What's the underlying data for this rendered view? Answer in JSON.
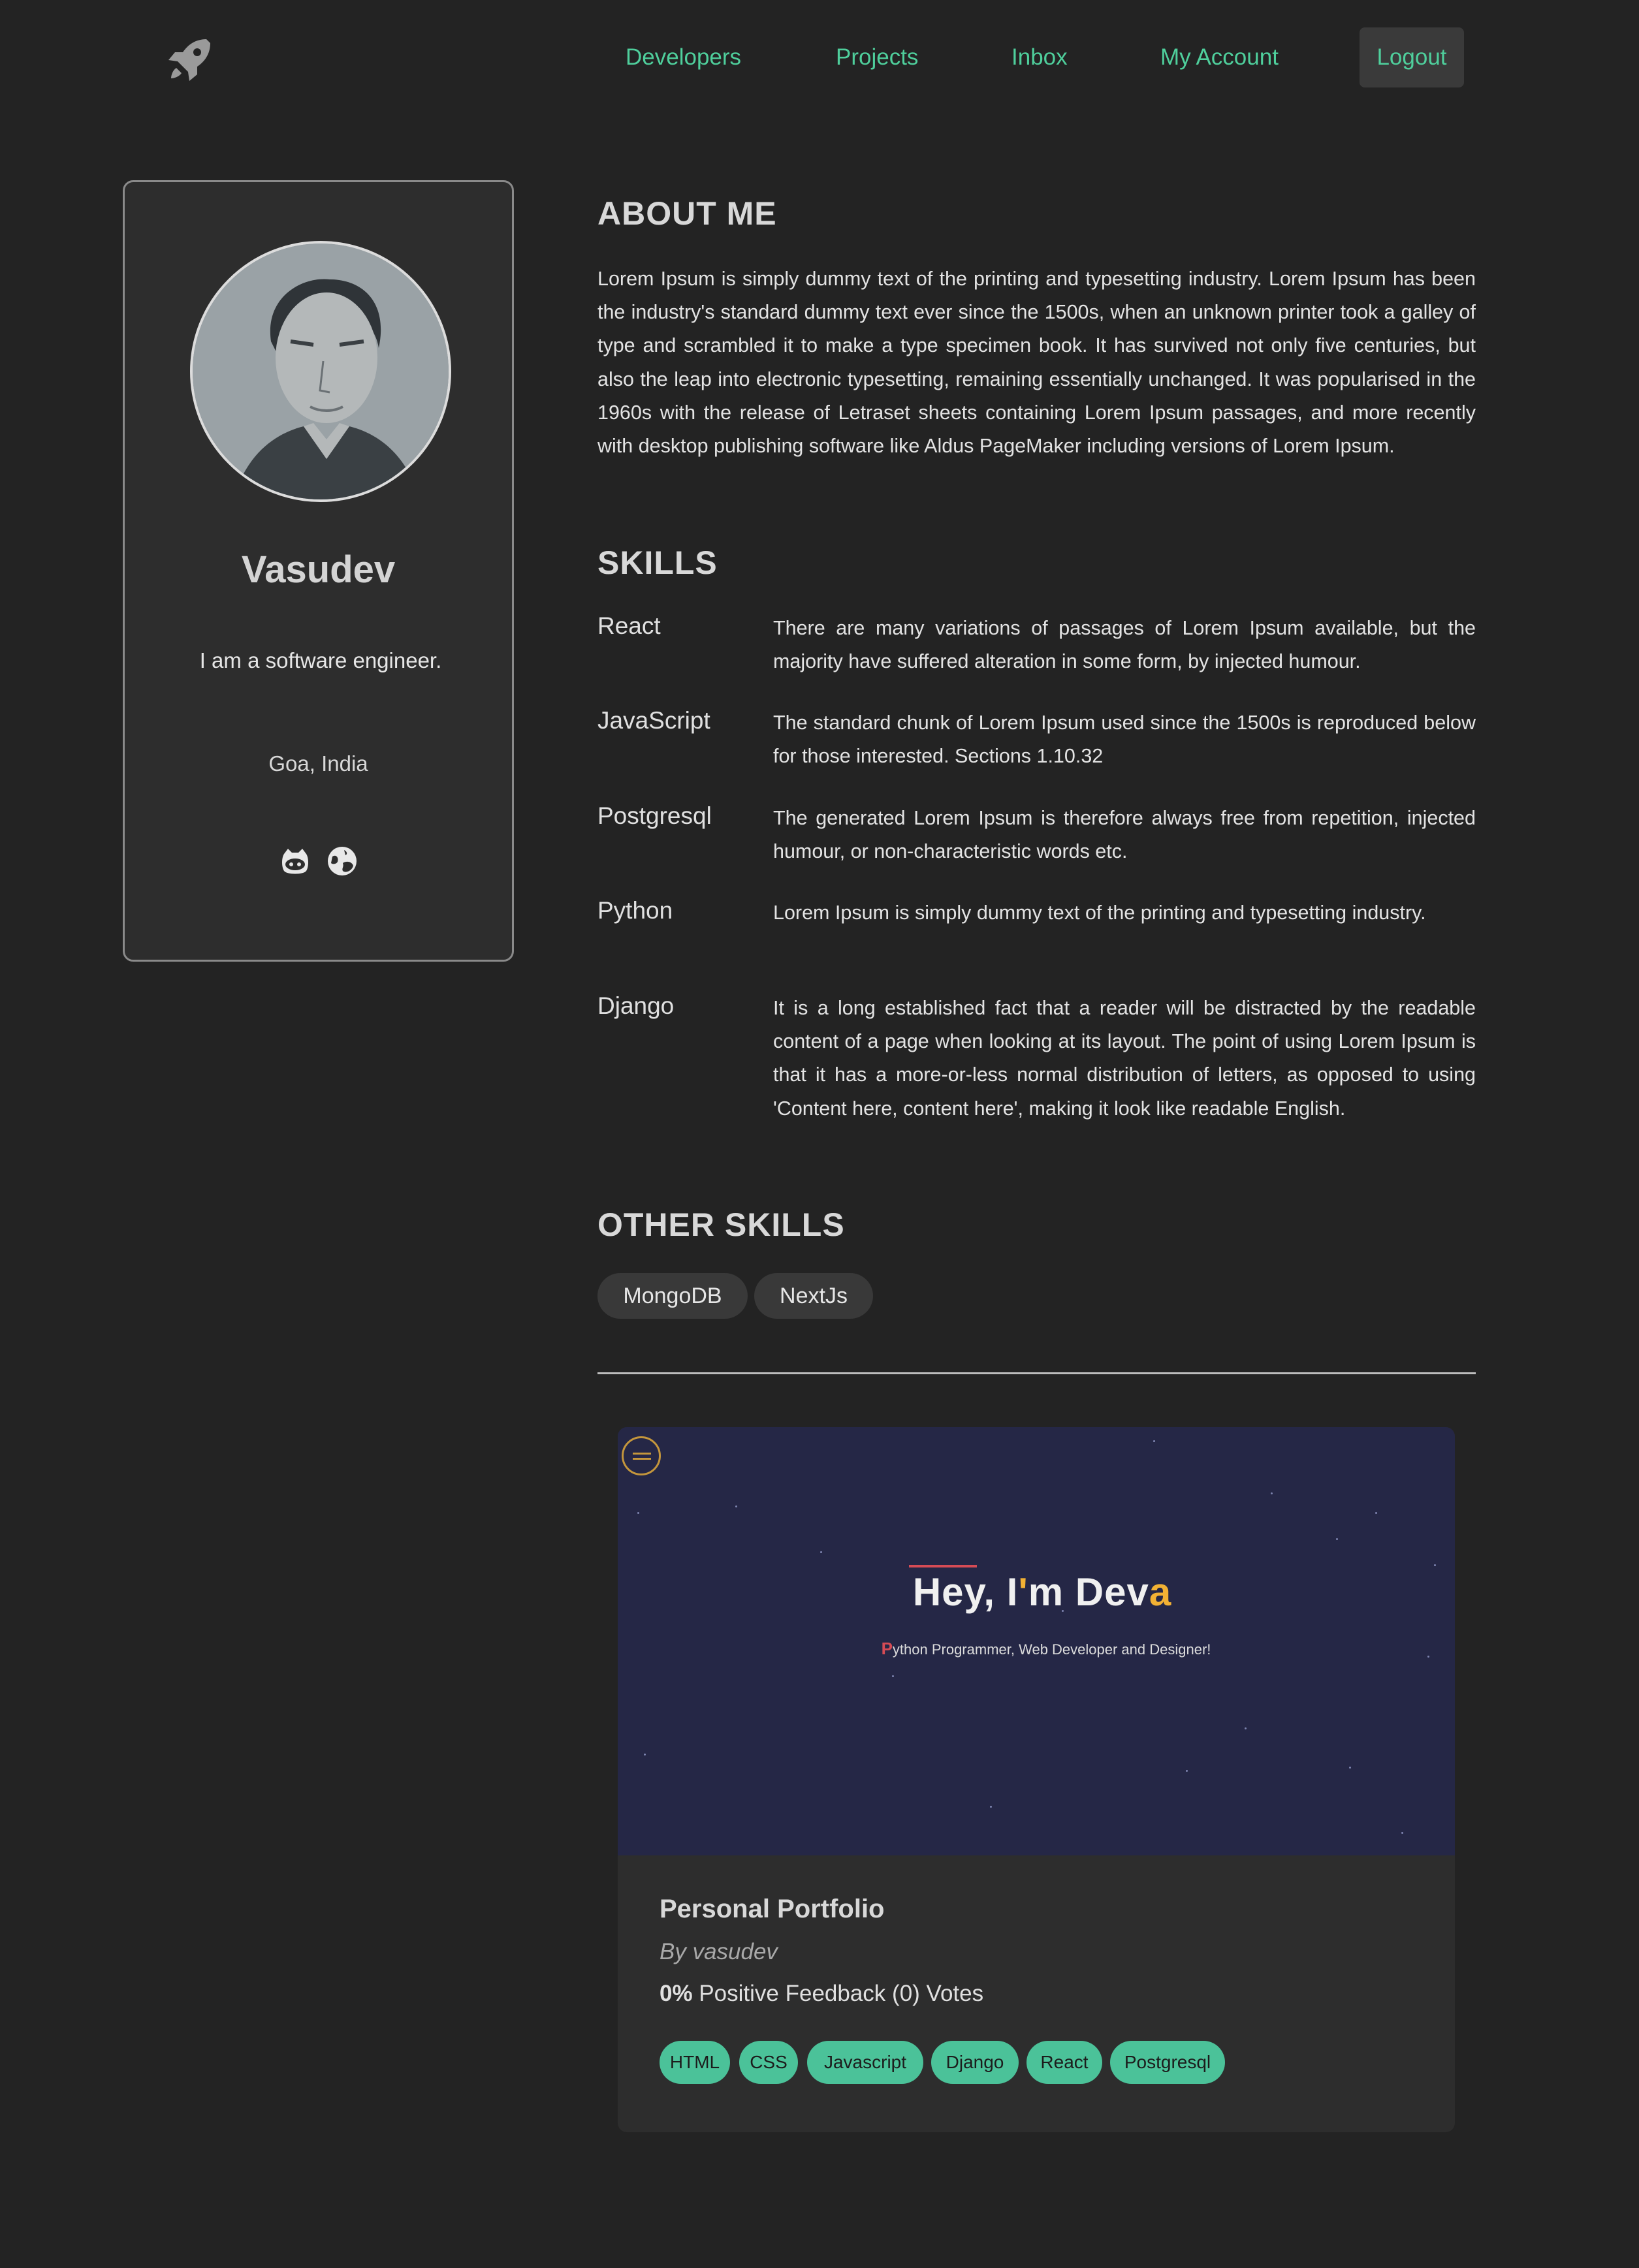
{
  "nav": {
    "logo_icon": "rocket-icon",
    "links": [
      "Developers",
      "Projects",
      "Inbox",
      "My Account"
    ],
    "logout": "Logout",
    "accent_color": "#4fcf9c"
  },
  "profile": {
    "name": "Vasudev",
    "bio": "I am a software engineer.",
    "location": "Goa, India",
    "social_icons": [
      "github-icon",
      "globe-icon"
    ]
  },
  "about": {
    "heading": "ABOUT ME",
    "text": "Lorem Ipsum is simply dummy text of the printing and typesetting industry. Lorem Ipsum has been the industry's standard dummy text ever since the 1500s, when an unknown printer took a galley of type and scrambled it to make a type specimen book. It has survived not only five centuries, but also the leap into electronic typesetting, remaining essentially unchanged. It was popularised in the 1960s with the release of Letraset sheets containing Lorem Ipsum passages, and more recently with desktop publishing software like Aldus PageMaker including versions of Lorem Ipsum."
  },
  "skills": {
    "heading": "SKILLS",
    "items": [
      {
        "name": "React",
        "description": "There are many variations of passages of Lorem Ipsum available, but the majority have suffered alteration in some form, by injected humour."
      },
      {
        "name": "JavaScript",
        "description": "The standard chunk of Lorem Ipsum used since the 1500s is reproduced below for those interested. Sections 1.10.32"
      },
      {
        "name": "Postgresql",
        "description": "The generated Lorem Ipsum is therefore always free from repetition, injected humour, or non-characteristic words etc."
      },
      {
        "name": "Python",
        "description": "Lorem Ipsum is simply dummy text of the printing and typesetting industry."
      },
      {
        "name": "Django",
        "description": "It is a long established fact that a reader will be distracted by the readable content of a page when looking at its layout. The point of using Lorem Ipsum is that it has a more-or-less normal distribution of letters, as opposed to using 'Content here, content here', making it look like readable English."
      }
    ]
  },
  "other_skills": {
    "heading": "OTHER SKILLS",
    "items": [
      "MongoDB",
      "NextJs"
    ]
  },
  "project": {
    "thumbnail": {
      "title_prefix": "Hey, I",
      "title_quote": "'",
      "title_mid": "m Dev",
      "title_end": "a",
      "subtitle_first": "P",
      "subtitle_rest": "ython Programmer, Web Developer and Designer!"
    },
    "title": "Personal Portfolio",
    "by": "By vasudev",
    "feedback_percent": "0%",
    "feedback_text": "Positive Feedback (0) Votes",
    "tags": [
      "HTML",
      "CSS",
      "Javascript",
      "Django",
      "React",
      "Postgresql"
    ],
    "tag_color": "#4bc299"
  }
}
